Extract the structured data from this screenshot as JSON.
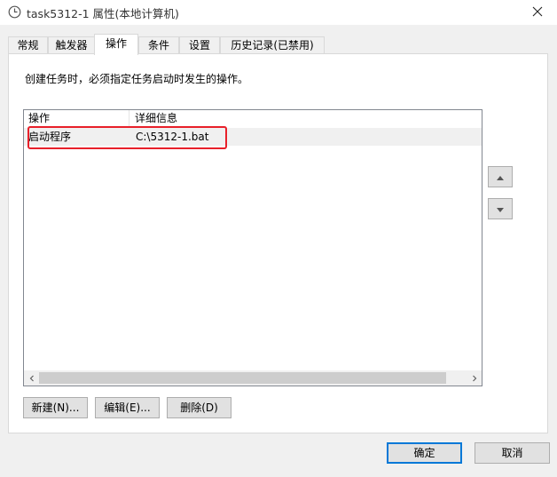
{
  "window": {
    "title": "task5312-1 属性(本地计算机)",
    "icon": "clock-icon",
    "close_icon": "close-icon"
  },
  "tabs": [
    {
      "label": "常规",
      "active": false
    },
    {
      "label": "触发器",
      "active": false
    },
    {
      "label": "操作",
      "active": true
    },
    {
      "label": "条件",
      "active": false
    },
    {
      "label": "设置",
      "active": false
    },
    {
      "label": "历史记录(已禁用)",
      "active": false
    }
  ],
  "panel": {
    "description": "创建任务时，必须指定任务启动时发生的操作。",
    "columns": [
      "操作",
      "详细信息"
    ],
    "rows": [
      {
        "action": "启动程序",
        "details": "C:\\5312-1.bat"
      }
    ],
    "highlight_color": "#e8202a",
    "move_up_icon": "triangle-up-icon",
    "move_down_icon": "triangle-down-icon",
    "buttons": {
      "new": "新建(N)...",
      "edit": "编辑(E)...",
      "delete": "删除(D)"
    }
  },
  "footer": {
    "ok": "确定",
    "cancel": "取消",
    "accent": "#0078d7"
  }
}
